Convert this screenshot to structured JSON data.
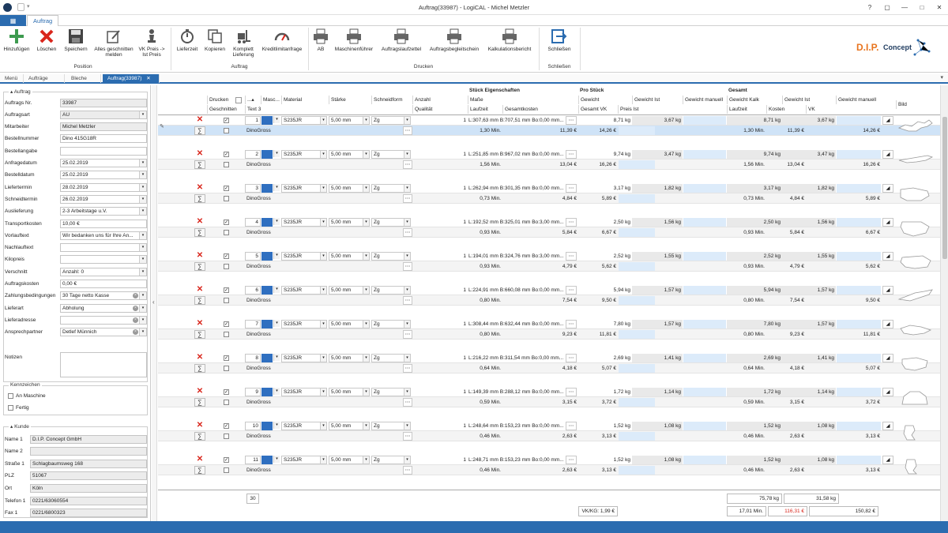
{
  "window": {
    "title": "Auftrag(33987) - LogiCAL - Michel Metzler"
  },
  "ribbon_tab": "Auftrag",
  "ribbon": {
    "buttons": [
      {
        "label": "Hinzufügen",
        "icon": "plus-icon"
      },
      {
        "label": "Löschen",
        "icon": "delete-x-icon"
      },
      {
        "label": "Speichern",
        "icon": "save-disk-icon"
      },
      {
        "label": "Alles geschnitten melden",
        "icon": "edit-check-icon"
      },
      {
        "label": "VK Preis -> Ist Preis",
        "icon": "chess-piece-icon"
      },
      {
        "label": "Lieferzeit",
        "icon": "stopwatch-icon"
      },
      {
        "label": "Kopieren",
        "icon": "copy-icon"
      },
      {
        "label": "Komplett Lieferung",
        "icon": "forklift-icon"
      },
      {
        "label": "Kreditlimitanfrage",
        "icon": "gauge-icon"
      },
      {
        "label": "AB",
        "icon": "printer-icon"
      },
      {
        "label": "Maschinenführer",
        "icon": "printer-icon"
      },
      {
        "label": "Auftragslaufzettel",
        "icon": "printer-icon"
      },
      {
        "label": "Auftragsbegleitschein",
        "icon": "printer-icon"
      },
      {
        "label": "Kalkulationsbericht",
        "icon": "printer-icon"
      },
      {
        "label": "Schließen",
        "icon": "exit-arrow-icon"
      }
    ],
    "groups": [
      "Position",
      "Auftrag",
      "Drucken",
      "Schließen"
    ],
    "logo_text_a": "D.I.P.",
    "logo_text_b": "Concept"
  },
  "doc_tabs": [
    {
      "label": "Menü"
    },
    {
      "label": "Aufträge"
    },
    {
      "label": "Bleche"
    },
    {
      "label": "Auftrag(33987)",
      "close": "✕"
    }
  ],
  "left": {
    "auftrag_header": "Auftrag",
    "fields": [
      {
        "label": "Auftrags Nr.",
        "value": "33987",
        "ro": true
      },
      {
        "label": "Auftragsart",
        "value": "AU",
        "dd": true,
        "ro": true
      },
      {
        "label": "Mitarbeiter",
        "value": "Michel Metzler",
        "ro": true
      },
      {
        "label": "Bestellnummer",
        "value": "Dino 415G18R"
      },
      {
        "label": "Bestellangabe",
        "value": ""
      },
      {
        "label": "Anfragedatum",
        "value": "25.02.2019",
        "dd": true
      },
      {
        "label": "Bestelldatum",
        "value": "25.02.2019",
        "dd": true
      },
      {
        "label": "Liefertermin",
        "value": "28.02.2019",
        "dd": true
      },
      {
        "label": "Schneidtermin",
        "value": "26.02.2019",
        "dd": true
      },
      {
        "label": "Auslieferung",
        "value": "2-3 Arbeitstage u.V.",
        "dd": true
      },
      {
        "label": "Transportkosten",
        "value": "10,00 €"
      },
      {
        "label": "Vorlauftext",
        "value": "Wir bedanken uns für Ihre An...",
        "dd": true
      },
      {
        "label": "Nachlauftext",
        "value": "",
        "dd": true
      },
      {
        "label": "Kilopreis",
        "value": "",
        "dd": true
      },
      {
        "label": "Verschnitt",
        "value": "Anzahl: 0",
        "dd": true
      },
      {
        "label": "Auftragskosten",
        "value": "0,00 €"
      },
      {
        "label": "Zahlungsbedingungen",
        "value": "30 Tage netto Kasse",
        "dd": true,
        "clr": true
      },
      {
        "label": "Lieferart",
        "value": "Abholung",
        "dd": true,
        "clr": true
      },
      {
        "label": "Lieferadresse",
        "value": "",
        "dd": true,
        "clr": true
      },
      {
        "label": "Ansprechpartner",
        "value": "Detlef Münnich",
        "dd": true,
        "clr": true
      }
    ],
    "notizen_label": "Notizen",
    "kennzeichen_header": "Kennzeichen",
    "kennzeichen": [
      "An Maschine",
      "Fertig"
    ],
    "kunde_header": "Kunde",
    "kunde": [
      {
        "label": "Name 1",
        "value": "D.I.P. Concept GmbH"
      },
      {
        "label": "Name 2",
        "value": ""
      },
      {
        "label": "Straße 1",
        "value": "Schlagbaumsweg 168"
      },
      {
        "label": "PLZ",
        "value": "51067"
      },
      {
        "label": "Ort",
        "value": "Köln"
      },
      {
        "label": "Telefon 1",
        "value": "0221/63060554"
      },
      {
        "label": "Fax 1",
        "value": "0221/6800323"
      }
    ]
  },
  "grid": {
    "group_headers": {
      "stueck": "Stück Eigenschaften",
      "pro_stueck": "Pro Stück",
      "gesamt": "Gesamt"
    },
    "headers_row1": {
      "drucken": "Drucken",
      "sort": "...",
      "masch": "Masc...",
      "material": "Material",
      "staerke": "Stärke",
      "schneidform": "Schneidform",
      "anzahl": "Anzahl",
      "masse": "Maße",
      "gewicht_p": "Gewicht",
      "gewicht_ist_p": "Gewicht Ist",
      "gewicht_manuell": "Gewicht manuell",
      "gewicht_kalk": "Gewicht Kalk",
      "gewicht_ist_g": "Gewicht Ist",
      "gewicht_manuell_g": "Gewicht manuell",
      "bild": "Bild"
    },
    "headers_row2": {
      "geschnitten": "Geschnitten",
      "text3": "Text 3",
      "qualitaet": "Qualität",
      "laufzeit": "Laufzeit",
      "gesamtkosten": "Gesamtkosten",
      "gesamt_vk": "Gesamt VK",
      "preis_ist": "Preis Ist",
      "laufzeit_g": "Laufzeit",
      "kosten_g": "Kosten",
      "vk_g": "VK"
    },
    "rows": [
      {
        "pos": "1",
        "mat": "S235JR",
        "staerke": "5,00 mm",
        "form": "Zg",
        "anzahl": "1",
        "masse": "L:307,63 mm B:707,51 mm Bo:0,00 mm...",
        "gew": "8,71 kg",
        "gew_ist": "3,67 kg",
        "text3": "DinoGross",
        "lauf": "1,30 Min.",
        "kosten": "11,39 €",
        "vk": "14,26 €",
        "g_gew": "8,71 kg",
        "g_ist": "3,67 kg",
        "g_lauf": "1,30 Min.",
        "g_kosten": "11,39 €",
        "g_vk": "14,26 €",
        "shape": "dino1"
      },
      {
        "pos": "2",
        "mat": "S235JR",
        "staerke": "5,00 mm",
        "form": "Zg",
        "anzahl": "1",
        "masse": "L:251,85 mm B:967,02 mm Bo:0,00 mm...",
        "gew": "9,74 kg",
        "gew_ist": "3,47 kg",
        "text3": "DinoGross",
        "lauf": "1,56 Min.",
        "kosten": "13,04 €",
        "vk": "16,26 €",
        "g_gew": "9,74 kg",
        "g_ist": "3,47 kg",
        "g_lauf": "1,56 Min.",
        "g_kosten": "13,04 €",
        "g_vk": "16,26 €",
        "shape": "dino2"
      },
      {
        "pos": "3",
        "mat": "S235JR",
        "staerke": "5,00 mm",
        "form": "Zg",
        "anzahl": "1",
        "masse": "L:262,94 mm B:301,35 mm Bo:0,00 mm...",
        "gew": "3,17 kg",
        "gew_ist": "1,82 kg",
        "text3": "DinoGross",
        "lauf": "0,73 Min.",
        "kosten": "4,84 €",
        "vk": "5,89 €",
        "g_gew": "3,17 kg",
        "g_ist": "1,82 kg",
        "g_lauf": "0,73 Min.",
        "g_kosten": "4,84 €",
        "g_vk": "5,89 €",
        "shape": "dino3"
      },
      {
        "pos": "4",
        "mat": "S235JR",
        "staerke": "5,00 mm",
        "form": "Zg",
        "anzahl": "1",
        "masse": "L:192,52 mm B:325,01 mm Bo:3,00 mm...",
        "gew": "2,50 kg",
        "gew_ist": "1,56 kg",
        "text3": "DinoGross",
        "lauf": "0,93 Min.",
        "kosten": "5,84 €",
        "vk": "6,67 €",
        "g_gew": "2,50 kg",
        "g_ist": "1,56 kg",
        "g_lauf": "0,93 Min.",
        "g_kosten": "5,84 €",
        "g_vk": "6,67 €",
        "shape": "dino4"
      },
      {
        "pos": "5",
        "mat": "S235JR",
        "staerke": "5,00 mm",
        "form": "Zg",
        "anzahl": "1",
        "masse": "L:194,01 mm B:324,76 mm Bo:3,00 mm...",
        "gew": "2,52 kg",
        "gew_ist": "1,55 kg",
        "text3": "DinoGross",
        "lauf": "0,93 Min.",
        "kosten": "4,79 €",
        "vk": "5,62 €",
        "g_gew": "2,52 kg",
        "g_ist": "1,55 kg",
        "g_lauf": "0,93 Min.",
        "g_kosten": "4,79 €",
        "g_vk": "5,62 €",
        "shape": "dino5"
      },
      {
        "pos": "6",
        "mat": "S235JR",
        "staerke": "5,00 mm",
        "form": "Zg",
        "anzahl": "1",
        "masse": "L:224,91 mm B:660,08 mm Bo:0,00 mm...",
        "gew": "5,94 kg",
        "gew_ist": "1,57 kg",
        "text3": "DinoGross",
        "lauf": "0,80 Min.",
        "kosten": "7,54 €",
        "vk": "9,50 €",
        "g_gew": "5,94 kg",
        "g_ist": "1,57 kg",
        "g_lauf": "0,80 Min.",
        "g_kosten": "7,54 €",
        "g_vk": "9,50 €",
        "shape": "dino6"
      },
      {
        "pos": "7",
        "mat": "S235JR",
        "staerke": "5,00 mm",
        "form": "Zg",
        "anzahl": "1",
        "masse": "L:308,44 mm B:632,44 mm Bo:0,00 mm...",
        "gew": "7,80 kg",
        "gew_ist": "1,57 kg",
        "text3": "DinoGross",
        "lauf": "0,80 Min.",
        "kosten": "9,23 €",
        "vk": "11,81 €",
        "g_gew": "7,80 kg",
        "g_ist": "1,57 kg",
        "g_lauf": "0,80 Min.",
        "g_kosten": "9,23 €",
        "g_vk": "11,81 €",
        "shape": "dino7"
      },
      {
        "pos": "8",
        "mat": "S235JR",
        "staerke": "5,00 mm",
        "form": "Zg",
        "anzahl": "1",
        "masse": "L:216,22 mm B:311,54 mm Bo:0,00 mm...",
        "gew": "2,69 kg",
        "gew_ist": "1,41 kg",
        "text3": "DinoGross",
        "lauf": "0,64 Min.",
        "kosten": "4,18 €",
        "vk": "5,07 €",
        "g_gew": "2,69 kg",
        "g_ist": "1,41 kg",
        "g_lauf": "0,64 Min.",
        "g_kosten": "4,18 €",
        "g_vk": "5,07 €",
        "shape": "dino8"
      },
      {
        "pos": "9",
        "mat": "S235JR",
        "staerke": "5,00 mm",
        "form": "Zg",
        "anzahl": "1",
        "masse": "L:149,39 mm B:288,12 mm Bo:0,00 mm...",
        "gew": "1,72 kg",
        "gew_ist": "1,14 kg",
        "text3": "DinoGross",
        "lauf": "0,59 Min.",
        "kosten": "3,15 €",
        "vk": "3,72 €",
        "g_gew": "1,72 kg",
        "g_ist": "1,14 kg",
        "g_lauf": "0,59 Min.",
        "g_kosten": "3,15 €",
        "g_vk": "3,72 €",
        "shape": "dino9"
      },
      {
        "pos": "10",
        "mat": "S235JR",
        "staerke": "5,00 mm",
        "form": "Zg",
        "anzahl": "1",
        "masse": "L:248,64 mm B:153,23 mm Bo:0,00 mm...",
        "gew": "1,52 kg",
        "gew_ist": "1,08 kg",
        "text3": "DinoGross",
        "lauf": "0,46 Min.",
        "kosten": "2,63 €",
        "vk": "3,13 €",
        "g_gew": "1,52 kg",
        "g_ist": "1,08 kg",
        "g_lauf": "0,46 Min.",
        "g_kosten": "2,63 €",
        "g_vk": "3,13 €",
        "shape": "dino10"
      },
      {
        "pos": "11",
        "mat": "S235JR",
        "staerke": "5,00 mm",
        "form": "Zg",
        "anzahl": "1",
        "masse": "L:248,71 mm B:153,23 mm Bo:0,00 mm...",
        "gew": "1,52 kg",
        "gew_ist": "1,08 kg",
        "text3": "DinoGross",
        "lauf": "0,46 Min.",
        "kosten": "2,63 €",
        "vk": "3,13 €",
        "g_gew": "1,52 kg",
        "g_ist": "1,08 kg",
        "g_lauf": "0,46 Min.",
        "g_kosten": "2,63 €",
        "g_vk": "3,13 €",
        "shape": "dino11"
      }
    ]
  },
  "footer": {
    "count": "30",
    "vk_kg": "VK/KG: 1,99 €",
    "sum_gewicht": "75,78 kg",
    "sum_ist": "31,58 kg",
    "sum_laufzeit": "17,01 Min.",
    "sum_kosten": "116,31 €",
    "sum_vk": "150,82 €"
  }
}
